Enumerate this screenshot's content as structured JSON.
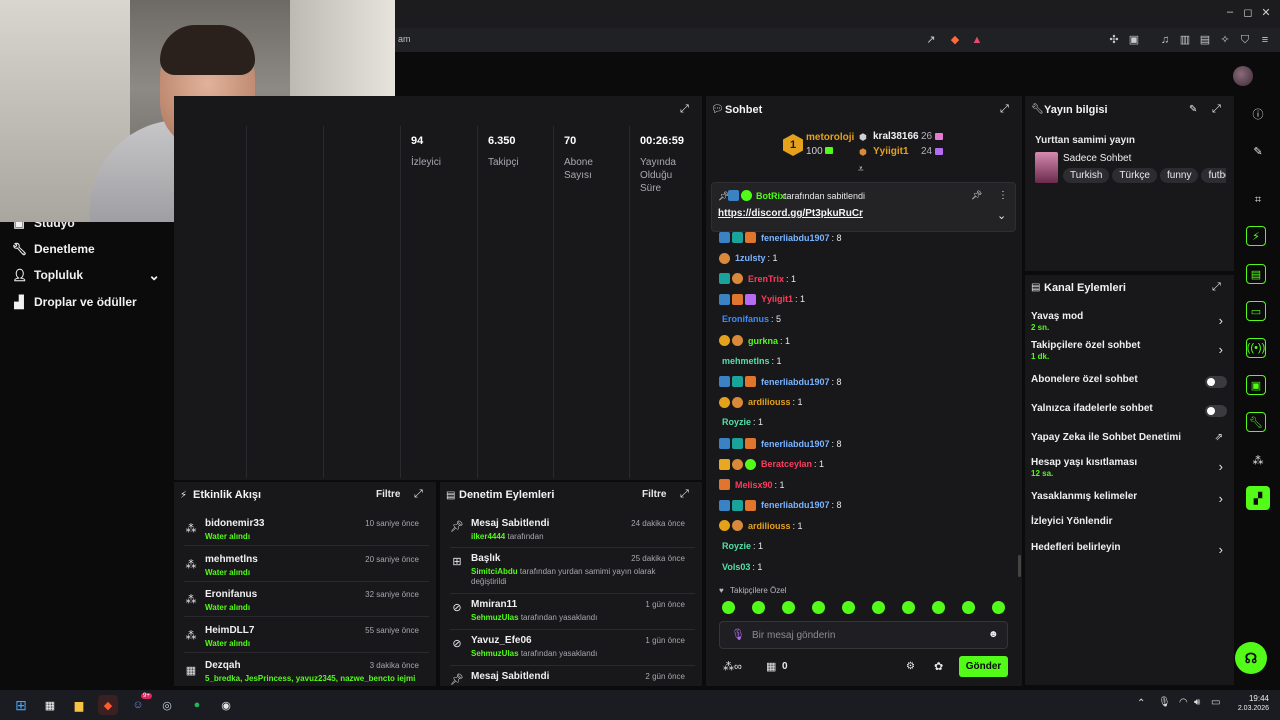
{
  "browser": {
    "url_fragment": "am",
    "window_controls": {
      "minimize": "–",
      "maximize": "◻",
      "close": "✕"
    }
  },
  "sidebar": {
    "items": [
      {
        "label": "Stüdyo",
        "icon": "studio-icon"
      },
      {
        "label": "Denetleme",
        "icon": "wrench-icon"
      },
      {
        "label": "Topluluk",
        "icon": "community-icon"
      },
      {
        "label": "Droplar ve ödüller",
        "icon": "drops-icon"
      }
    ],
    "chevron": "⌄"
  },
  "stats": {
    "columns": [
      {
        "value": "94",
        "label": "İzleyici"
      },
      {
        "value": "6.350",
        "label": "Takipçi"
      },
      {
        "value": "70",
        "label": "Abone Sayısı"
      },
      {
        "value": "00:26:59",
        "label": "Yayında Olduğu Süre"
      }
    ]
  },
  "chat": {
    "title": "Sohbet",
    "leaderboard": [
      {
        "rank": "1",
        "name": "metoroloji",
        "score": "100"
      },
      {
        "name": "kral38166",
        "score": "26"
      },
      {
        "name": "Yyiigit1",
        "score": "24"
      }
    ],
    "pinned": {
      "by_user": "BotRix",
      "by_text": "tarafından sabitlendi",
      "link": "https://discord.gg/Pt3pkuRuCr"
    },
    "messages": [
      {
        "user": "fenerliabdu1907",
        "text": ": 8",
        "color": "#7ab4ff"
      },
      {
        "user": "1zulsty",
        "text": ": 1",
        "color": "#7ab4ff"
      },
      {
        "user": "ErenTrix",
        "text": ": 1",
        "color": "#ff3b5c"
      },
      {
        "user": "Yyiigit1",
        "text": ": 1",
        "color": "#ff3b5c"
      },
      {
        "user": "Eronifanus",
        "text": ": 5",
        "color": "#3b8bff"
      },
      {
        "user": "gurkna",
        "text": ": 1",
        "color": "#53fc18"
      },
      {
        "user": "mehmetlns",
        "text": ": 1",
        "color": "#53e0a6"
      },
      {
        "user": "fenerliabdu1907",
        "text": ": 8",
        "color": "#7ab4ff"
      },
      {
        "user": "ardiliouss",
        "text": ": 1",
        "color": "#e4a11b"
      },
      {
        "user": "Royzie",
        "text": ": 1",
        "color": "#53e0a6"
      },
      {
        "user": "fenerliabdu1907",
        "text": ": 8",
        "color": "#7ab4ff"
      },
      {
        "user": "Beratceylan",
        "text": ": 1",
        "color": "#ff3b5c"
      },
      {
        "user": "Melisx90",
        "text": ": 1",
        "color": "#ff3b5c"
      },
      {
        "user": "fenerliabdu1907",
        "text": ": 8",
        "color": "#7ab4ff"
      },
      {
        "user": "ardiliouss",
        "text": ": 1",
        "color": "#e4a11b"
      },
      {
        "user": "Royzie",
        "text": ": 1",
        "color": "#53e0a6"
      },
      {
        "user": "Vols03",
        "text": ": 1",
        "color": "#53e0a6"
      }
    ],
    "followers_only_label": "Takipçilere Özel",
    "input_placeholder": "Bir mesaj gönderin",
    "points": "0",
    "send_label": "Gönder"
  },
  "stream_info": {
    "title": "Yayın bilgisi",
    "stream_title": "Yurttan samimi yayın",
    "category": "Sadece Sohbet",
    "tags": [
      "Turkish",
      "Türkçe",
      "funny",
      "futbo"
    ]
  },
  "channel_actions": {
    "title": "Kanal Eylemleri",
    "items": [
      {
        "label": "Yavaş mod",
        "sub": "2 sn.",
        "control": "chevron"
      },
      {
        "label": "Takipçilere özel sohbet",
        "sub": "1 dk.",
        "control": "chevron"
      },
      {
        "label": "Abonelere özel sohbet",
        "sub": "",
        "control": "toggle"
      },
      {
        "label": "Yalnızca ifadelerle sohbet",
        "sub": "",
        "control": "toggle"
      },
      {
        "label": "Yapay Zeka ile Sohbet Denetimi",
        "sub": "",
        "control": "external"
      },
      {
        "label": "Hesap yaşı kısıtlaması",
        "sub": "12 sa.",
        "control": "chevron"
      },
      {
        "label": "Yasaklanmış kelimeler",
        "sub": "",
        "control": "chevron"
      },
      {
        "label": "İzleyici Yönlendir",
        "sub": "",
        "control": "none"
      },
      {
        "label": "Hedefleri belirleyin",
        "sub": "",
        "control": "chevron"
      }
    ]
  },
  "activity_feed": {
    "title": "Etkinlik Akışı",
    "filter_label": "Filtre",
    "items": [
      {
        "name": "bidonemir33",
        "sub": "Water alındı",
        "time": "10 saniye önce"
      },
      {
        "name": "mehmetlns",
        "sub": "Water alındı",
        "time": "20 saniye önce"
      },
      {
        "name": "Eronifanus",
        "sub": "Water alındı",
        "time": "32 saniye önce"
      },
      {
        "name": "HeimDLL7",
        "sub": "Water alındı",
        "time": "55 saniye önce"
      },
      {
        "name": "Dezqah",
        "sub": "5_bredka, JesPrincess, yavuz2345, nazwe_bencto iejmi",
        "time": "3 dakika önce"
      }
    ]
  },
  "mod_actions": {
    "title": "Denetim Eylemleri",
    "filter_label": "Filtre",
    "items": [
      {
        "name": "Mesaj Sabitlendi",
        "user": "ilker4444",
        "rest": "tarafından",
        "time": "24 dakika önce",
        "icon": "pin-icon"
      },
      {
        "name": "Başlık",
        "user": "SimitciAbdu",
        "rest": "tarafından yurdan samimi yayın olarak değiştirildi",
        "time": "25 dakika önce",
        "icon": "title-icon"
      },
      {
        "name": "Mmiran11",
        "user": "SehmuzUlas",
        "rest": "tarafından yasaklandı",
        "time": "1 gün önce",
        "icon": "ban-icon"
      },
      {
        "name": "Yavuz_Efe06",
        "user": "SehmuzUlas",
        "rest": "tarafından yasaklandı",
        "time": "1 gün önce",
        "icon": "ban-icon"
      },
      {
        "name": "Mesaj Sabitlendi",
        "user": "",
        "rest": "",
        "time": "2 gün önce",
        "icon": "pin-icon"
      }
    ]
  },
  "taskbar": {
    "time": "19:44",
    "date": "2.03.2026",
    "notification_count": "9+"
  },
  "colors": {
    "accent": "#53fc18",
    "panel": "#18181b",
    "bg": "#0b0b0c"
  }
}
